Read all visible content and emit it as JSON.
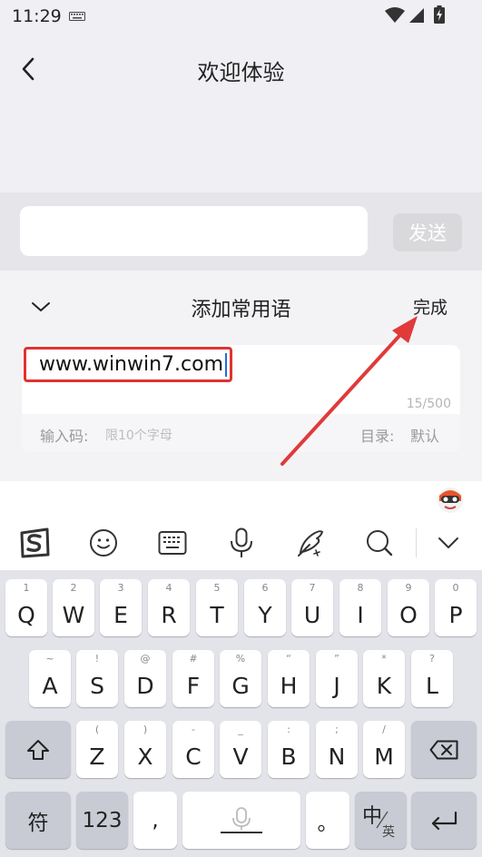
{
  "status": {
    "time": "11:29"
  },
  "nav": {
    "title": "欢迎体验"
  },
  "send_bar": {
    "input_value": "",
    "send_label": "发送"
  },
  "panel": {
    "title": "添加常用语",
    "done_label": "完成",
    "phrase_value": "www.winwin7.com",
    "counter": "15/500",
    "code_label": "输入码:",
    "code_placeholder": "限10个字母",
    "dir_label": "目录:",
    "dir_value": "默认"
  },
  "icons": {
    "toolbar": [
      "sogou-logo-icon",
      "emoji-icon",
      "keyboard-icon",
      "microphone-icon",
      "handwriting-icon",
      "search-icon",
      "collapse-keyboard-icon"
    ]
  },
  "keyboard": {
    "row1": [
      {
        "main": "Q",
        "sub": "1"
      },
      {
        "main": "W",
        "sub": "2"
      },
      {
        "main": "E",
        "sub": "3"
      },
      {
        "main": "R",
        "sub": "4"
      },
      {
        "main": "T",
        "sub": "5"
      },
      {
        "main": "Y",
        "sub": "6"
      },
      {
        "main": "U",
        "sub": "7"
      },
      {
        "main": "I",
        "sub": "8"
      },
      {
        "main": "O",
        "sub": "9"
      },
      {
        "main": "P",
        "sub": "0"
      }
    ],
    "row2": [
      {
        "main": "A",
        "sub": "~"
      },
      {
        "main": "S",
        "sub": "!"
      },
      {
        "main": "D",
        "sub": "@"
      },
      {
        "main": "F",
        "sub": "#"
      },
      {
        "main": "G",
        "sub": "%"
      },
      {
        "main": "H",
        "sub": "“"
      },
      {
        "main": "J",
        "sub": "”"
      },
      {
        "main": "K",
        "sub": "*"
      },
      {
        "main": "L",
        "sub": "?"
      }
    ],
    "row3": [
      {
        "main": "Z",
        "sub": "("
      },
      {
        "main": "X",
        "sub": ")"
      },
      {
        "main": "C",
        "sub": "-"
      },
      {
        "main": "V",
        "sub": "_"
      },
      {
        "main": "B",
        "sub": ":"
      },
      {
        "main": "N",
        "sub": ";"
      },
      {
        "main": "M",
        "sub": "/"
      }
    ],
    "symbol_label": "符",
    "num_label": "123",
    "comma_label": ",",
    "period_label": "。",
    "lang_main": "中",
    "lang_sub": "英"
  },
  "colors": {
    "highlight_box": "#e03232",
    "annotation_arrow": "#e03a3a",
    "caret": "#1e6fd9"
  }
}
